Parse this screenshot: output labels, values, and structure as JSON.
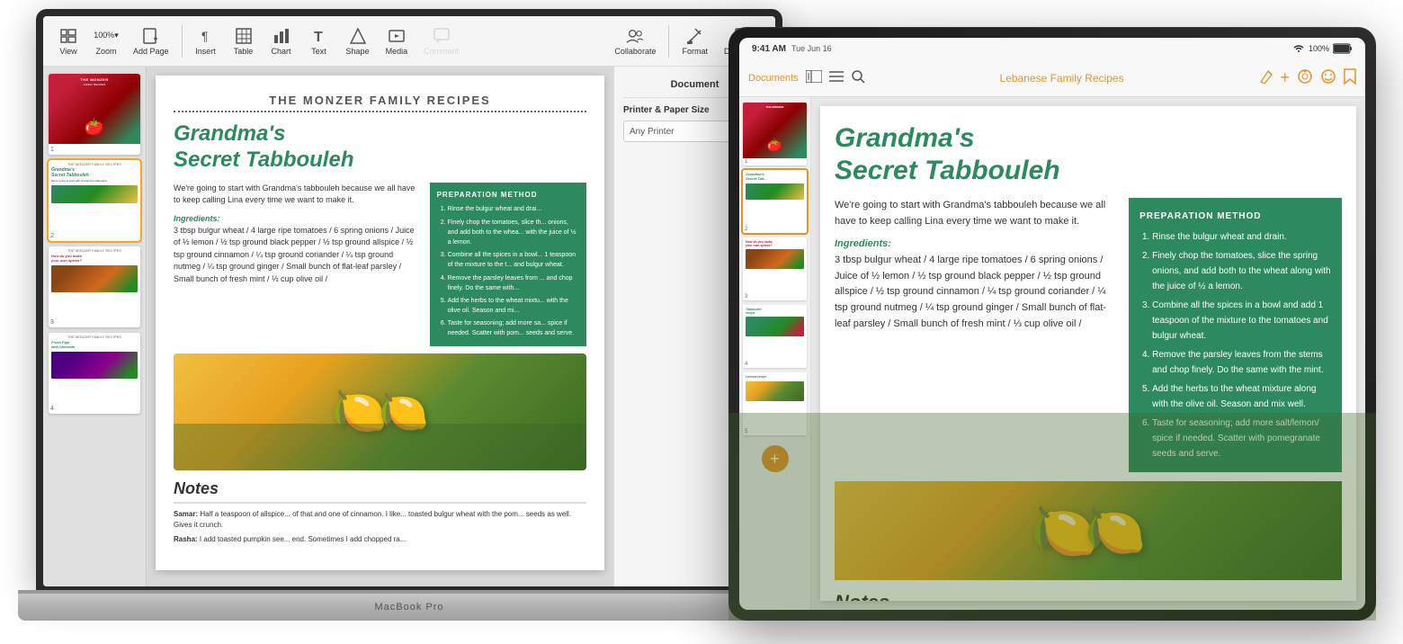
{
  "scene": {
    "background": "#ffffff"
  },
  "macbook": {
    "label": "MacBook Pro",
    "toolbar": {
      "items": [
        {
          "id": "view",
          "label": "View",
          "icon": "⊞"
        },
        {
          "id": "zoom",
          "label": "Zoom",
          "icon": "100%▾"
        },
        {
          "id": "add-page",
          "label": "Add Page",
          "icon": "+□"
        },
        {
          "id": "insert",
          "label": "Insert",
          "icon": "¶"
        },
        {
          "id": "table",
          "label": "Table",
          "icon": "⊞"
        },
        {
          "id": "chart",
          "label": "Chart",
          "icon": "📊"
        },
        {
          "id": "text",
          "label": "Text",
          "icon": "T"
        },
        {
          "id": "shape",
          "label": "Shape",
          "icon": "△"
        },
        {
          "id": "media",
          "label": "Media",
          "icon": "🖼"
        },
        {
          "id": "comment",
          "label": "Comment",
          "icon": "💬"
        },
        {
          "id": "collaborate",
          "label": "Collaborate",
          "icon": "👥"
        },
        {
          "id": "format",
          "label": "Format",
          "icon": "✏"
        },
        {
          "id": "document",
          "label": "Document",
          "icon": "📄"
        }
      ]
    },
    "doc_panel": {
      "header": "Document",
      "printer_label": "Printer & Paper Size",
      "printer_value": "Any Printer"
    },
    "page": {
      "doc_title": "THE MONZER FAMILY RECIPES",
      "recipe_title_line1": "Grandma's",
      "recipe_title_line2": "Secret Tabbouleh",
      "intro_text": "We're going to start with Grandma's tabbouleh because we all have to keep calling Lina every time we want to make it.",
      "ingredients_label": "Ingredients:",
      "ingredients_text": "3 tbsp bulgur wheat / 4 large ripe tomatoes / 6 spring onions / Juice of ½ lemon / ½ tsp ground black pepper / ½ tsp ground allspice / ½ tsp ground cinnamon / ¼ tsp ground coriander / ¼ tsp ground nutmeg / ¼ tsp ground ginger / Small bunch of flat-leaf parsley / Small bunch of fresh mint / ⅓ cup olive oil /",
      "prep_title": "PREPARATION METHOD",
      "prep_steps": [
        "Rinse the bulgur wheat and drai...",
        "Finely chop the tomatoes, slice th... onions, and add both to the whea... with the juice of ½ a lemon.",
        "Combine all the spices in a bowl... 1 teaspoon of the mixture to the t... and bulgur wheat.",
        "Remove the parsley leaves from ... and chop finely. Do the same with...",
        "Add the herbs to the wheat mixtu... with the olive oil. Season and mi...",
        "Taste for seasoning; add more sa... spice if needed. Scatter with pom... seeds and serve."
      ],
      "notes_title": "Notes",
      "notes_samar_name": "Samar:",
      "notes_samar_text": " Half a teaspoon of allspice... of that and one of cinnamon. I like... toasted bulgur wheat with the pom... seeds as well. Gives it crunch.",
      "notes_rasha_name": "Rasha:",
      "notes_rasha_text": " I add toasted pumpkin see... end. Sometimes I add chopped ra..."
    },
    "sidebar": {
      "pages": [
        {
          "num": "1",
          "type": "cover"
        },
        {
          "num": "2",
          "type": "recipe",
          "selected": true
        },
        {
          "num": "3",
          "type": "spices"
        },
        {
          "num": "4",
          "type": "figs"
        }
      ]
    }
  },
  "ipad": {
    "statusbar": {
      "time": "9:41 AM",
      "date": "Tue Jun 16",
      "wifi": "wifi",
      "battery": "100%"
    },
    "toolbar": {
      "documents_btn": "Documents",
      "doc_title": "Lebanese Family Recipes"
    },
    "page": {
      "recipe_title_line1": "Grandma's",
      "recipe_title_line2": "Secret Tabbouleh",
      "intro_text": "We're going to start with Grandma's tabbouleh because we all have to keep calling Lina every time we want to make it.",
      "ingredients_label": "Ingredients:",
      "ingredients_text": "3 tbsp bulgur wheat / 4 large ripe tomatoes / 6 spring onions / Juice of ½ lemon / ½ tsp ground black pepper / ½ tsp ground allspice / ½ tsp ground cinnamon / ¼ tsp ground coriander / ¼ tsp ground nutmeg / ¼ tsp ground ginger / Small bunch of flat-leaf parsley / Small bunch of fresh mint / ⅓ cup olive oil /",
      "prep_title": "PREPARATION METHOD",
      "prep_steps": [
        "Rinse the bulgur wheat and drain.",
        "Finely chop the tomatoes, slice the spring onions, and add both to the wheat along with the juice of ½ a lemon.",
        "Combine all the spices in a bowl and add 1 teaspoon of the mixture to the tomatoes and bulgur wheat.",
        "Remove the parsley leaves from the stems and chop finely. Do the same with the mint.",
        "Add the herbs to the wheat mixture along with the olive oil. Season and mix well.",
        "Taste for seasoning; add more salt/lemon/ spice if needed. Scatter with pomegranate seeds and serve."
      ],
      "notes_title": "Notes"
    },
    "sidebar": {
      "pages": [
        {
          "num": "1",
          "type": "cover"
        },
        {
          "num": "2",
          "type": "recipe",
          "selected": true
        },
        {
          "num": "3",
          "type": "spices"
        },
        {
          "num": "4",
          "type": "tabbouleh"
        },
        {
          "num": "5",
          "type": "lemons"
        }
      ],
      "add_btn": "+"
    }
  }
}
